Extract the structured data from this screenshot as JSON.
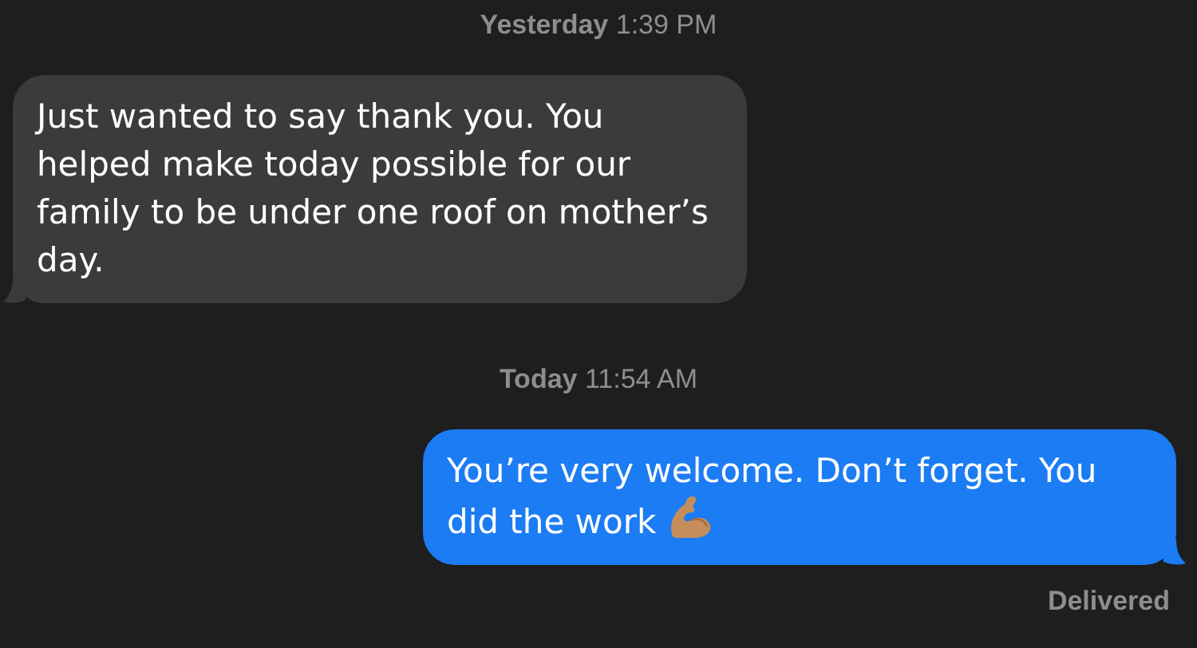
{
  "messages": [
    {
      "kind": "timestamp",
      "text": "**Yesterday** 1:39 PM"
    },
    {
      "kind": "incoming",
      "text": "Just wanted to say thank you. You helped make today possible for our family to be under one roof on mother’s day."
    },
    {
      "kind": "timestamp",
      "text": "**Today** 11:54 AM"
    },
    {
      "kind": "outgoing",
      "text": "You’re very welcome. Don’t forget. You did the work",
      "attachments": [
        {
          "kind": "biceps"
        }
      ]
    },
    {
      "kind": "status",
      "text": "Delivered"
    }
  ]
}
